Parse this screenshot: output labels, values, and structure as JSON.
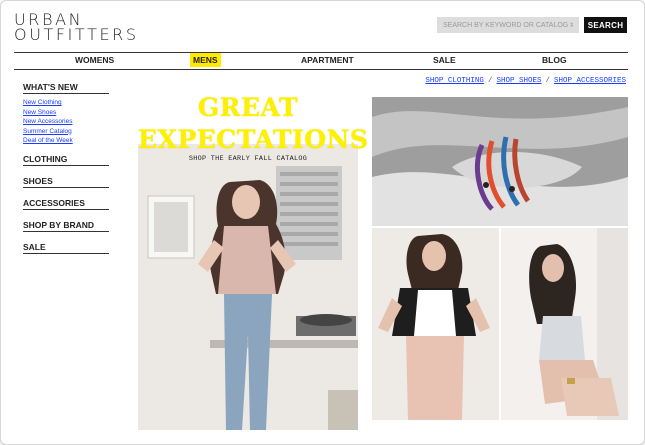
{
  "brand": {
    "line1": "URBAN",
    "line2": "OUTFITTERS"
  },
  "search": {
    "placeholder": "SEARCH BY KEYWORD OR CATALOG #",
    "button": "SEARCH"
  },
  "nav": {
    "items": [
      "WOMENS",
      "MENS",
      "APARTMENT",
      "SALE",
      "BLOG"
    ],
    "active": "MENS"
  },
  "sidebar": {
    "whats_new": "WHAT'S NEW",
    "sub_items": [
      "New Clothing",
      "New Shoes",
      "New Accessories",
      "Summer Catalog",
      "Deal of the Week"
    ],
    "sections": [
      "CLOTHING",
      "SHOES",
      "ACCESSORIES",
      "SHOP BY BRAND",
      "SALE"
    ]
  },
  "shop_links": [
    "SHOP CLOTHING",
    "SHOP SHOES",
    "SHOP ACCESSORIES"
  ],
  "promo": {
    "title_line1": "GREAT",
    "title_line2": "EXPECTATIONS",
    "subtitle": "SHOP THE EARLY FALL CATALOG"
  },
  "colors": {
    "nav_highlight": "#ffea00",
    "promo_title": "#fff000",
    "link": "#1a3cff"
  }
}
